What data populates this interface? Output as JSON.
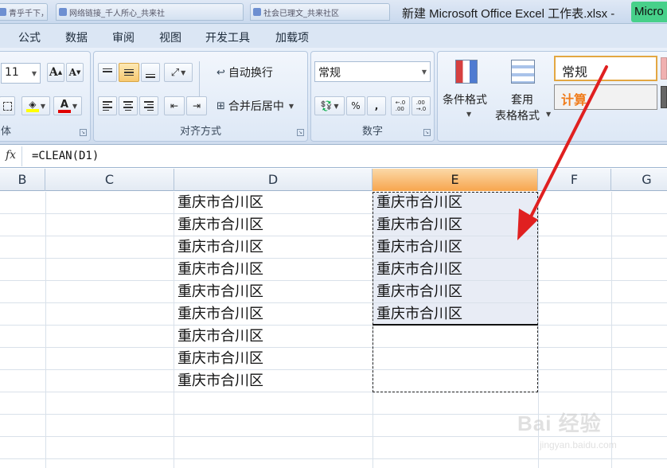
{
  "title_bar": {
    "tabs": [
      "青乎千下，",
      "网络链接_千人所心_共来社",
      "社会已理文_共来社区"
    ],
    "doc_title": "新建 Microsoft Office Excel 工作表.xlsx -",
    "app_name": "Micro"
  },
  "ribbon_tabs": [
    "公式",
    "数据",
    "审阅",
    "视图",
    "开发工具",
    "加载项"
  ],
  "font_group": {
    "font_size": "11",
    "group_label": "体"
  },
  "alignment_group": {
    "wrap_text": "自动换行",
    "merge_center": "合并后居中",
    "group_label": "对齐方式"
  },
  "number_group": {
    "format_value": "常规",
    "percent": "%",
    "comma": ",",
    "inc_decimal": "+.0\n.00",
    "group_label": "数字"
  },
  "styles_group": {
    "conditional_format": "条件格式",
    "format_table_line1": "套用",
    "format_table_line2": "表格格式",
    "style_normal": "常规",
    "style_calc": "计算"
  },
  "formula_bar": {
    "fx": "fx",
    "formula": "=CLEAN(D1)"
  },
  "columns": [
    "B",
    "C",
    "D",
    "E",
    "F",
    "G"
  ],
  "rows": [
    {
      "D": "重庆市合川区",
      "E": "重庆市合川区"
    },
    {
      "D": "重庆市合川区",
      "E": "重庆市合川区"
    },
    {
      "D": "重庆市合川区",
      "E": "重庆市合川区"
    },
    {
      "D": "重庆市合川区",
      "E": "重庆市合川区"
    },
    {
      "D": "重庆市合川区",
      "E": "重庆市合川区"
    },
    {
      "D": "重庆市合川区",
      "E": "重庆市合川区"
    },
    {
      "D": "重庆市合川区",
      "E": ""
    },
    {
      "D": "重庆市合川区",
      "E": ""
    },
    {
      "D": "重庆市合川区",
      "E": ""
    }
  ],
  "watermark": {
    "main": "Bai 经验",
    "sub": "jingyan.baidu.com"
  },
  "colors": {
    "selected_header": "#f7a54d",
    "annotation_arrow": "#e02020"
  }
}
